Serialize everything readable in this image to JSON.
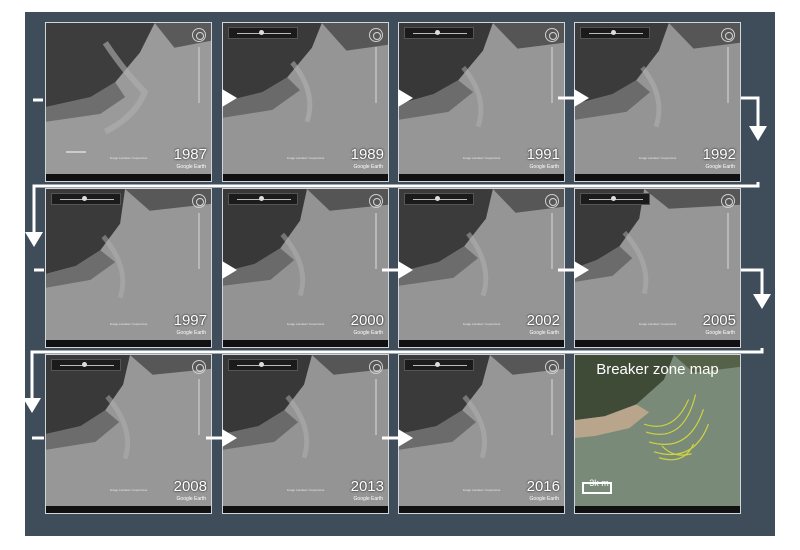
{
  "panels": [
    {
      "year": "1987",
      "credit": "Image Landsat / Copernicus",
      "logo": "Google Earth"
    },
    {
      "year": "1989",
      "credit": "Image Landsat / Copernicus",
      "logo": "Google Earth"
    },
    {
      "year": "1991",
      "credit": "Image Landsat / Copernicus",
      "logo": "Google Earth"
    },
    {
      "year": "1992",
      "credit": "Image Landsat / Copernicus",
      "logo": "Google Earth"
    },
    {
      "year": "1997",
      "credit": "Image Landsat / Copernicus",
      "logo": "Google Earth"
    },
    {
      "year": "2000",
      "credit": "Image Landsat / Copernicus",
      "logo": "Google Earth"
    },
    {
      "year": "2002",
      "credit": "Image Landsat / Copernicus",
      "logo": "Google Earth"
    },
    {
      "year": "2005",
      "credit": "Image Landsat / Copernicus",
      "logo": "Google Earth"
    },
    {
      "year": "2008",
      "credit": "Image Landsat / Copernicus",
      "logo": "Google Earth"
    },
    {
      "year": "2013",
      "credit": "Image Landsat / Copernicus",
      "logo": "Google Earth"
    },
    {
      "year": "2016",
      "credit": "Image Landsat / Copernicus",
      "logo": "Google Earth"
    }
  ],
  "breaker": {
    "title": "Breaker zone map",
    "scale_label": "3k m"
  },
  "colors": {
    "frame": "#3f4c5a",
    "arrow": "#ffffff",
    "breaker_lines": "#d9dc3c"
  },
  "icons": [
    "right-arrow-icon",
    "down-arrow-icon",
    "navigation-compass-icon",
    "zoom-slider-icon"
  ]
}
